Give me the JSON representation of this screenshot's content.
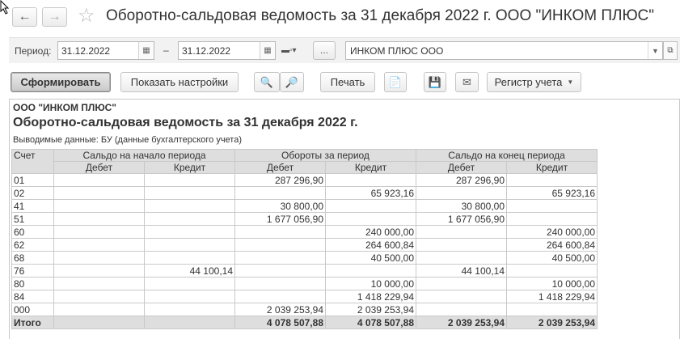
{
  "window": {
    "title": "Оборотно-сальдовая ведомость за 31 декабря 2022 г. ООО \"ИНКОМ ПЛЮС\""
  },
  "params": {
    "period_label": "Период:",
    "date_from": "31.12.2022",
    "separator": "–",
    "date_to": "31.12.2022",
    "dots_label": "...",
    "organization": "ИНКОМ ПЛЮС ООО"
  },
  "toolbar": {
    "generate": "Сформировать",
    "show_settings": "Показать настройки",
    "print": "Печать",
    "registry": "Регистр учета"
  },
  "report": {
    "org": "ООО \"ИНКОМ ПЛЮС\"",
    "title": "Оборотно-сальдовая ведомость за 31 декабря 2022 г.",
    "subtitle": "Выводимые данные: БУ (данные бухгалтерского учета)",
    "headers": {
      "account": "Счет",
      "opening": "Сальдо на начало периода",
      "turnover": "Обороты за период",
      "closing": "Сальдо на конец периода",
      "debit": "Дебет",
      "credit": "Кредит"
    },
    "rows": [
      [
        "01",
        "",
        "",
        "287 296,90",
        "",
        "287 296,90",
        ""
      ],
      [
        "02",
        "",
        "",
        "",
        "65 923,16",
        "",
        "65 923,16"
      ],
      [
        "41",
        "",
        "",
        "30 800,00",
        "",
        "30 800,00",
        ""
      ],
      [
        "51",
        "",
        "",
        "1 677 056,90",
        "",
        "1 677 056,90",
        ""
      ],
      [
        "60",
        "",
        "",
        "",
        "240 000,00",
        "",
        "240 000,00"
      ],
      [
        "62",
        "",
        "",
        "",
        "264 600,84",
        "",
        "264 600,84"
      ],
      [
        "68",
        "",
        "",
        "",
        "40 500,00",
        "",
        "40 500,00"
      ],
      [
        "76",
        "",
        "44 100,14",
        "",
        "",
        "44 100,14",
        ""
      ],
      [
        "80",
        "",
        "",
        "",
        "10 000,00",
        "",
        "10 000,00"
      ],
      [
        "84",
        "",
        "",
        "",
        "1 418 229,94",
        "",
        "1 418 229,94"
      ],
      [
        "000",
        "",
        "",
        "2 039 253,94",
        "2 039 253,94",
        "",
        ""
      ]
    ],
    "total": [
      "Итого",
      "",
      "",
      "4 078 507,88",
      "4 078 507,88",
      "2 039 253,94",
      "2 039 253,94"
    ]
  }
}
